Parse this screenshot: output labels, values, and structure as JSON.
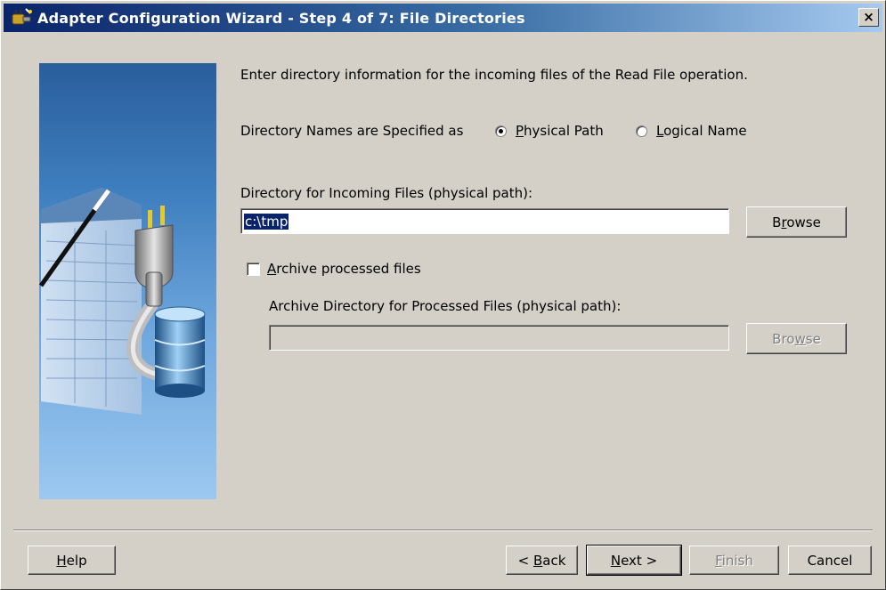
{
  "window": {
    "title": "Adapter Configuration Wizard - Step 4 of 7: File Directories",
    "close_label": "×"
  },
  "instructions": "Enter directory information for the incoming files of the Read File operation.",
  "directory_names": {
    "label": "Directory Names are Specified as",
    "options": [
      {
        "label": "Physical Path",
        "mnemonic": "P",
        "selected": true
      },
      {
        "label": "Logical Name",
        "mnemonic": "L",
        "selected": false
      }
    ]
  },
  "incoming": {
    "label": "Directory for Incoming Files (physical path):",
    "value": "c:\\tmp",
    "browse_label": "Browse",
    "browse_mnemonic": "r"
  },
  "archive": {
    "checkbox_label": "Archive processed files",
    "checkbox_mnemonic": "A",
    "checked": false,
    "dir_label": "Archive Directory for Processed Files (physical path):",
    "value": "",
    "browse_label": "Browse",
    "browse_mnemonic": "w"
  },
  "footer": {
    "help": "Help",
    "back": "< Back",
    "next": "Next >",
    "finish": "Finish",
    "cancel": "Cancel"
  },
  "colors": {
    "titlebar_start": "#0a246a",
    "titlebar_end": "#a6caf0",
    "dialog_bg": "#d4d0c8",
    "selection": "#0a246a"
  }
}
